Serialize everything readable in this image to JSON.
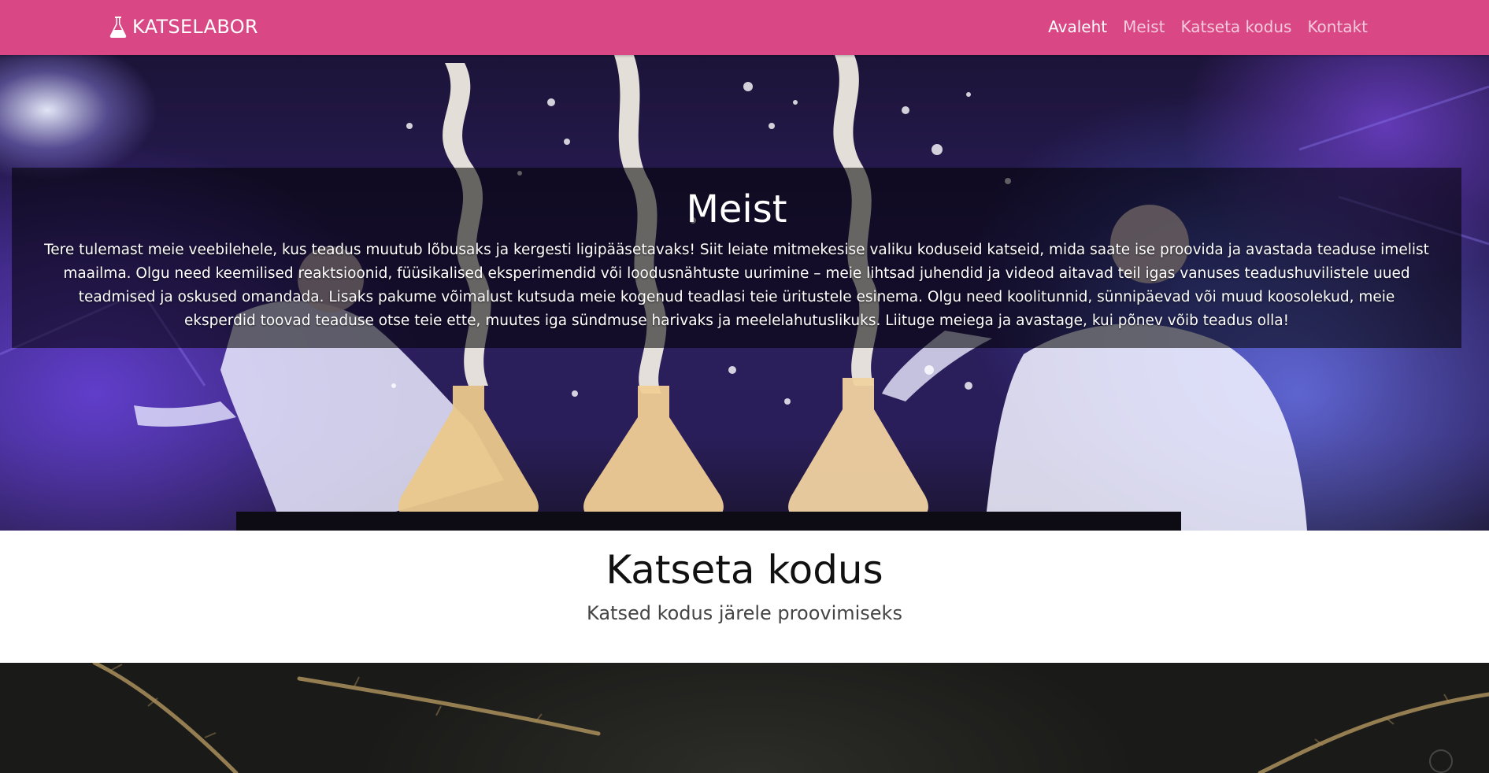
{
  "navbar": {
    "brand": "KATSELABOR",
    "brand_icon": "flask-icon",
    "background": "#d94785",
    "links": [
      {
        "label": "Avaleht",
        "active": true
      },
      {
        "label": "Meist",
        "active": false
      },
      {
        "label": "Katseta kodus",
        "active": false
      },
      {
        "label": "Kontakt",
        "active": false
      }
    ]
  },
  "hero": {
    "title": "Meist",
    "text": "Tere tulemast meie veebilehele, kus teadus muutub lõbusaks ja kergesti ligipääsetavaks! Siit leiate mitmekesise valiku koduseid katseid, mida saate ise proovida ja avastada teaduse imelist maailma. Olgu need keemilised reaktsioonid, füüsikalised eksperimendid või loodusnähtuste uurimine – meie lihtsad juhendid ja videod aitavad teil igas vanuses teadushuvilistele uued teadmised ja oskused omandada. Lisaks pakume võimalust kutsuda meie kogenud teadlasi teie üritustele esinema. Olgu need koolitunnid, sünnipäevad või muud koosolekud, meie eksperdid toovad teaduse otse teie ette, muutes iga sündmuse harivaks ja meelelahutuslikuks. Liituge meiega ja avastage, kui põnev võib teadus olla!"
  },
  "section": {
    "title": "Katseta kodus",
    "subtitle": "Katsed kodus järele proovimiseks"
  }
}
